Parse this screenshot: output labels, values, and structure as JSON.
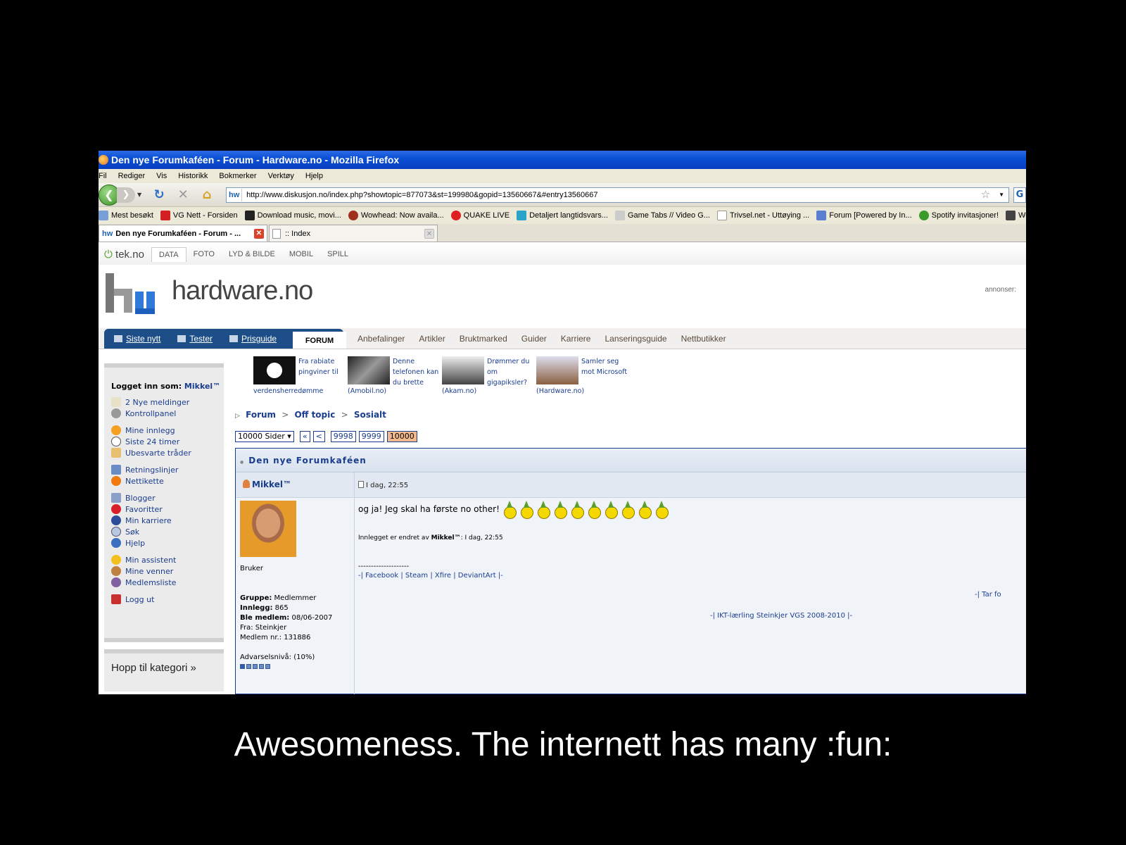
{
  "window": {
    "title": "Den nye Forumkaféen - Forum - Hardware.no - Mozilla Firefox"
  },
  "menu": [
    "Fil",
    "Rediger",
    "Vis",
    "Historikk",
    "Bokmerker",
    "Verktøy",
    "Hjelp"
  ],
  "address": {
    "url": "http://www.diskusjon.no/index.php?showtopic=877073&st=199980&gopid=13560667&#entry13560667"
  },
  "bookmarks": [
    "Mest besøkt",
    "VG Nett - Forsiden",
    "Download music, movi...",
    "Wowhead: Now availa...",
    "QUAKE LIVE",
    "Detaljert langtidsvars...",
    "Game Tabs // Video G...",
    "Trivsel.net - Uttøying ...",
    "Forum [Powered by In...",
    "Spotify invitasjoner!",
    "We Did"
  ],
  "tabs": [
    {
      "label": "Den nye Forumkaféen - Forum - ..."
    },
    {
      "label": ":: Index"
    }
  ],
  "teknav": {
    "logo": "tek.no",
    "items": [
      "DATA",
      "FOTO",
      "LYD & BILDE",
      "MOBIL",
      "SPILL"
    ]
  },
  "site": {
    "name": "hardware.no",
    "annonser": "annonser:"
  },
  "mainnav": {
    "items": [
      "Siste nytt",
      "Tester",
      "Prisguide"
    ],
    "forum": "FORUM"
  },
  "subnav": [
    "Anbefalinger",
    "Artikler",
    "Bruktmarked",
    "Guider",
    "Karriere",
    "Lanseringsguide",
    "Nettbutikker"
  ],
  "sidebar": {
    "login_label": "Logget inn som: ",
    "login_user": "Mikkel™",
    "groups": [
      [
        "2 Nye meldinger",
        "Kontrollpanel"
      ],
      [
        "Mine innlegg",
        "Siste 24 timer",
        "Ubesvarte tråder"
      ],
      [
        "Retningslinjer",
        "Nettikette"
      ],
      [
        "Blogger",
        "Favoritter",
        "Min karriere",
        "Søk",
        "Hjelp"
      ],
      [
        "Min assistent",
        "Mine venner",
        "Medlemsliste"
      ],
      [
        "Logg ut"
      ]
    ],
    "hopp": "Hopp til kategori »"
  },
  "news": [
    {
      "text": "Fra rabiate pingviner til",
      "source": "verdensherredømme"
    },
    {
      "text": "Denne telefonen kan du brette",
      "source": "(Amobil.no)"
    },
    {
      "text": "Drømmer du om gigapiksler?",
      "source": "(Akam.no)"
    },
    {
      "text": "Samler seg mot Microsoft",
      "source": "(Hardware.no)"
    }
  ],
  "breadcrumb": [
    "Forum",
    "Off topic",
    "Sosialt"
  ],
  "pager": {
    "pages": "10000 Sider",
    "first": "«",
    "prev": "<",
    "p1": "9998",
    "p2": "9999",
    "current": "10000"
  },
  "post": {
    "thread_title": "Den nye Forumkaféen",
    "author": "Mikkel™",
    "date": "I dag, 22:55",
    "rank": "Bruker",
    "group_label": "Gruppe:",
    "group": "Medlemmer",
    "posts_label": "Innlegg:",
    "posts": "865",
    "joined_label": "Ble medlem:",
    "joined": "08/06-2007",
    "from": "Fra: Steinkjer",
    "member_no": "Medlem nr.: 131886",
    "warn": "Advarselsnivå: (10%)",
    "warn_level": 0.1,
    "smiley_count": 10,
    "text": "og ja! Jeg skal ha første no other!",
    "edit_prefix": "Innlegget er endret av ",
    "edit_user": "Mikkel™",
    "edit_suffix": ": I dag, 22:55",
    "dashes": "--------------------",
    "sig": "-| Facebook | Steam | Xfire | DeviantArt |-",
    "sig2": "-| Tar fo",
    "sig3": "-| IKT-lærling Steinkjer VGS 2008-2010 |-"
  },
  "caption": "Awesomeness. The internett has many :fun:"
}
